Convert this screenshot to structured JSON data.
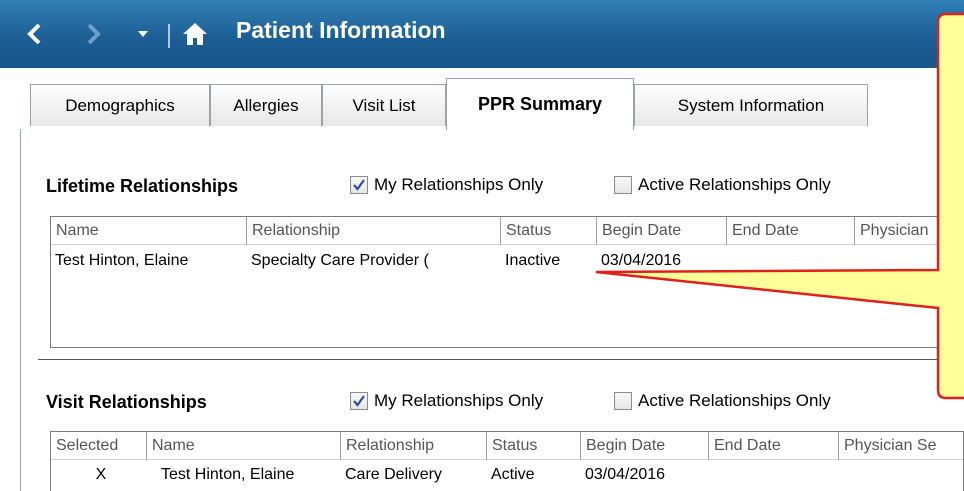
{
  "window": {
    "title": "Patient Information"
  },
  "nav": {
    "back_icon": "chevron-left-icon",
    "forward_icon": "chevron-right-icon",
    "dropdown_icon": "caret-down-icon",
    "home_icon": "home-icon"
  },
  "tabs": [
    {
      "label": "Demographics"
    },
    {
      "label": "Allergies"
    },
    {
      "label": "Visit List"
    },
    {
      "label": "PPR Summary"
    },
    {
      "label": "System Information"
    }
  ],
  "lifetime": {
    "title": "Lifetime Relationships",
    "my_only": {
      "label": "My Relationships Only",
      "checked": true
    },
    "active_only": {
      "label": "Active Relationships Only",
      "checked": false
    },
    "columns": [
      "Name",
      "Relationship",
      "Status",
      "Begin Date",
      "End Date",
      "Physician"
    ],
    "rows": [
      [
        "Test Hinton, Elaine",
        "Specialty Care Provider (",
        "Inactive",
        "03/04/2016",
        "",
        ""
      ]
    ]
  },
  "visit": {
    "title": "Visit Relationships",
    "my_only": {
      "label": "My Relationships Only",
      "checked": true
    },
    "active_only": {
      "label": "Active Relationships Only",
      "checked": false
    },
    "columns": [
      "Selected",
      "Name",
      "Relationship",
      "Status",
      "Begin Date",
      "End Date",
      "Physician Se"
    ],
    "rows": [
      [
        "X",
        "Test Hinton, Elaine",
        "Care Delivery",
        "Active",
        "03/04/2016",
        "",
        ""
      ]
    ]
  },
  "colors": {
    "titlebar": "#1d5f95",
    "callout_fill": "#ffff99",
    "callout_stroke": "#e0201a"
  }
}
